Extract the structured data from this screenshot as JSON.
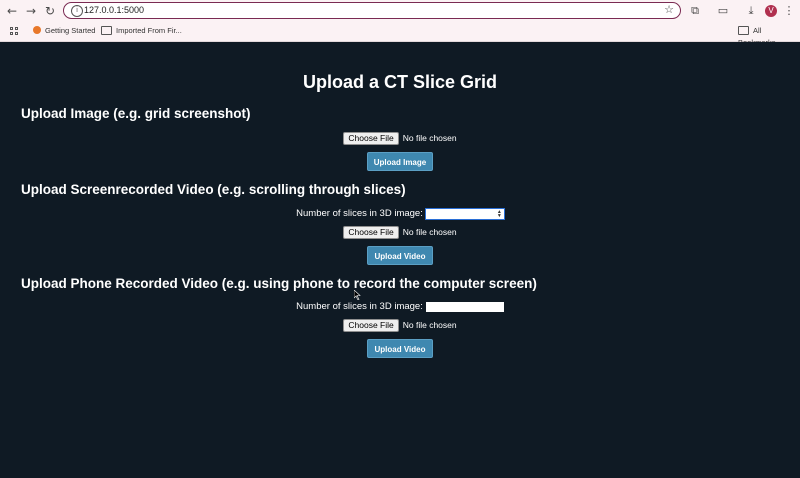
{
  "browser": {
    "url": "127.0.0.1:5000",
    "avatar_letter": "V",
    "bookmarks": [
      {
        "label": "Getting Started"
      },
      {
        "label": "Imported From Fir..."
      }
    ],
    "all_bookmarks_label": "All Bookmarks"
  },
  "page": {
    "title": "Upload a CT Slice Grid",
    "image_section": {
      "heading": "Upload Image (e.g. grid screenshot)",
      "choose_file_label": "Choose File",
      "no_file_text": "No file chosen",
      "submit_label": "Upload Image"
    },
    "screen_video_section": {
      "heading": "Upload Screenrecorded Video (e.g. scrolling through slices)",
      "slices_label": "Number of slices in 3D image:",
      "slices_value": "",
      "choose_file_label": "Choose File",
      "no_file_text": "No file chosen",
      "submit_label": "Upload Video"
    },
    "phone_video_section": {
      "heading": "Upload Phone Recorded Video (e.g. using phone to record the computer screen)",
      "slices_label": "Number of slices in 3D image:",
      "slices_value": "",
      "choose_file_label": "Choose File",
      "no_file_text": "No file chosen",
      "submit_label": "Upload Video"
    }
  },
  "colors": {
    "background": "#0f1a24",
    "button": "#3f88b0",
    "url_border": "#7a2a52"
  }
}
